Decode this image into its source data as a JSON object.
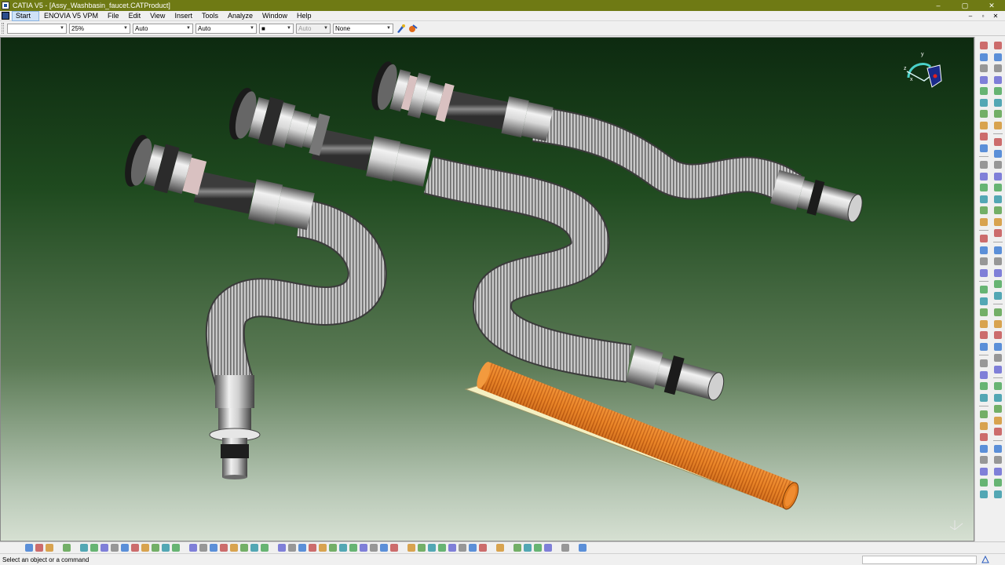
{
  "window": {
    "title": "CATIA V5 - [Assy_Washbasin_faucet.CATProduct]",
    "controls": [
      "–",
      "▢",
      "✕"
    ]
  },
  "menu": {
    "items": [
      "Start",
      "ENOVIA V5 VPM",
      "File",
      "Edit",
      "View",
      "Insert",
      "Tools",
      "Analyze",
      "Window",
      "Help"
    ],
    "mdi_controls": [
      "–",
      "▫",
      "✕"
    ]
  },
  "properties": {
    "fill_color": "",
    "transparency": "25%",
    "line_thickness": "Auto",
    "line_type": "Auto",
    "point_symbol": "■",
    "layer_disabled": "Auto",
    "layer": "None"
  },
  "viewport": {
    "background_top": "#0d2a10",
    "background_bottom": "#d6e0d2",
    "parts": [
      "left-siphon-assembly",
      "middle-siphon-assembly",
      "back-siphon-assembly",
      "orange-hose-section"
    ],
    "compass_axes": [
      "x",
      "y",
      "z"
    ]
  },
  "status": {
    "message": "Select an object or a command"
  },
  "icons": {
    "right_toolbar": "assembly-design-tools",
    "bottom_toolbar": "standard-view-tools"
  },
  "colors": {
    "titlebar": "#6f7a14",
    "metal": "#b8b8b8",
    "hose_orange": "#e07a1e",
    "sleeve_cream": "#f4f0c2"
  }
}
